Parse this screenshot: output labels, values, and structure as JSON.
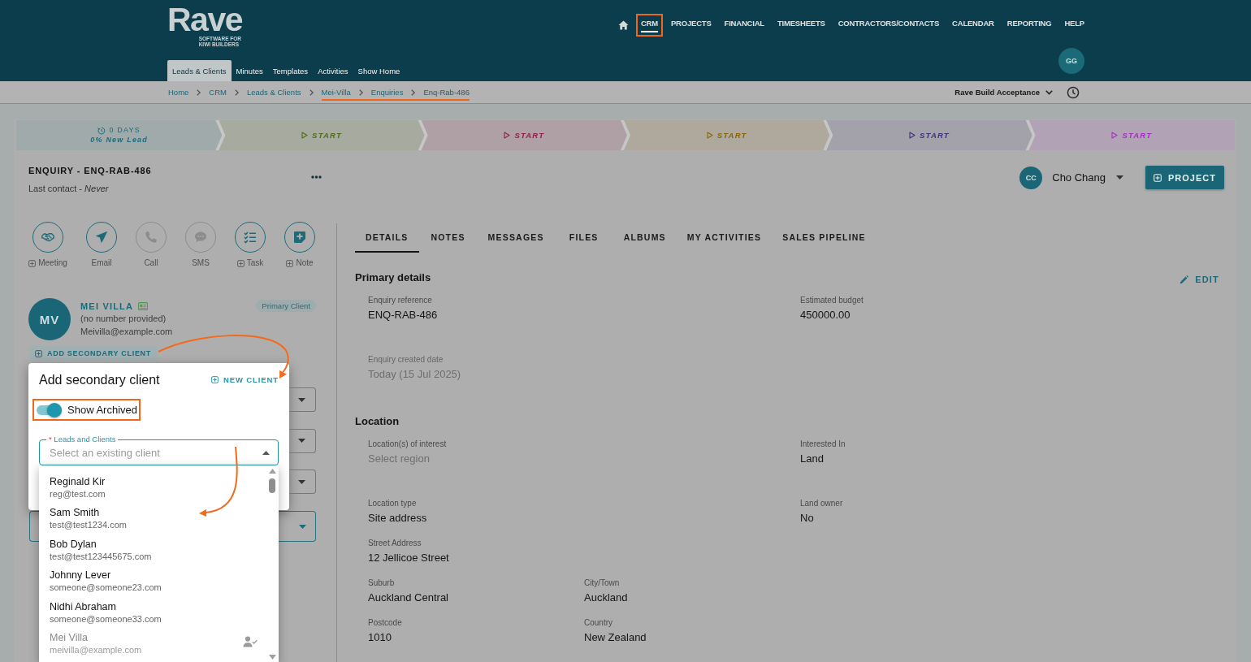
{
  "header": {
    "logo": {
      "name": "Rave",
      "tagline": [
        "SOFTWARE FOR",
        "KIWI BUILDERS"
      ]
    },
    "nav": [
      {
        "label": "CRM",
        "selected": true,
        "highlighted": true
      },
      {
        "label": "PROJECTS",
        "selected": false,
        "highlighted": false
      },
      {
        "label": "FINANCIAL",
        "selected": false,
        "highlighted": false
      },
      {
        "label": "TIMESHEETS",
        "selected": false,
        "highlighted": false
      },
      {
        "label": "CONTRACTORS/CONTACTS",
        "selected": false,
        "highlighted": false
      },
      {
        "label": "CALENDAR",
        "selected": false,
        "highlighted": false
      },
      {
        "label": "REPORTING",
        "selected": false,
        "highlighted": false
      },
      {
        "label": "HELP",
        "selected": false,
        "highlighted": false
      }
    ],
    "subnav": [
      {
        "label": "Leads & Clients",
        "selected": true
      },
      {
        "label": "Minutes",
        "selected": false
      },
      {
        "label": "Templates",
        "selected": false
      },
      {
        "label": "Activities",
        "selected": false
      },
      {
        "label": "Show Home",
        "selected": false
      }
    ],
    "user_initials": "GG"
  },
  "breadcrumbs": {
    "items": [
      {
        "label": "Home",
        "current": false,
        "underlined": false
      },
      {
        "label": "CRM",
        "current": false,
        "underlined": false
      },
      {
        "label": "Leads & Clients",
        "current": false,
        "underlined": false
      },
      {
        "label": "Mei-Villa",
        "current": false,
        "underlined": true
      },
      {
        "label": "Enquiries",
        "current": false,
        "underlined": true
      },
      {
        "label": "Enq-Rab-486",
        "current": true,
        "underlined": true
      }
    ],
    "company": "Rave Build Acceptance"
  },
  "pipeline": [
    {
      "kind": "current",
      "color": "#1d6b79",
      "days": "0 DAYS",
      "status": "0% New Lead"
    },
    {
      "kind": "start",
      "color": "#4e6b1c",
      "label": "START"
    },
    {
      "kind": "start",
      "color": "#8d1f4a",
      "label": "START"
    },
    {
      "kind": "start",
      "color": "#8a6500",
      "label": "START"
    },
    {
      "kind": "start",
      "color": "#3b3278",
      "label": "START"
    },
    {
      "kind": "start",
      "color": "#a22fc0",
      "label": "START"
    }
  ],
  "enquiry": {
    "title": "ENQUIRY - ENQ-RAB-486",
    "last_contact": "Last contact - *Never*",
    "assignee": {
      "initials": "CC",
      "name": "Cho Chang"
    },
    "project_button": "PROJECT"
  },
  "actions": [
    {
      "label": "Meeting",
      "kind": "add",
      "disabled": false
    },
    {
      "label": "Email",
      "kind": "direct",
      "disabled": false
    },
    {
      "label": "Call",
      "kind": "direct",
      "disabled": true
    },
    {
      "label": "SMS",
      "kind": "direct",
      "disabled": true
    },
    {
      "label": "Task",
      "kind": "add",
      "disabled": false
    },
    {
      "label": "Note",
      "kind": "add",
      "disabled": false
    }
  ],
  "client": {
    "initials": "MV",
    "name": "MEI VILLA",
    "phone": "(no number provided)",
    "email": "Meivilla@example.com",
    "badge": "Primary Client"
  },
  "add_secondary_button": "ADD SECONDARY CLIENT",
  "client_form_fields": [
    {
      "focused": false
    },
    {
      "focused": false
    },
    {
      "focused": false
    },
    {
      "focused": true
    }
  ],
  "popup": {
    "title": "Add secondary client",
    "new_client_button": "NEW CLIENT",
    "show_archived": {
      "label": "Show Archived",
      "on": true,
      "highlighted": true
    },
    "field": {
      "required_mark": "*",
      "label": "Leads and Clients",
      "placeholder": "Select an existing client",
      "expanded": true
    },
    "options": [
      {
        "name": "Reginald Kir",
        "email": "reg@test.com",
        "disabled": false
      },
      {
        "name": "Sam Smith",
        "email": "test@test1234.com",
        "disabled": false
      },
      {
        "name": "Bob Dylan",
        "email": "test@test123445675.com",
        "disabled": false
      },
      {
        "name": "Johnny Lever",
        "email": "someone@someone23.com",
        "disabled": false
      },
      {
        "name": "Nidhi Abraham",
        "email": "someone@someone33.com",
        "disabled": false
      },
      {
        "name": "Mei Villa",
        "email": "meivilla@example.com",
        "disabled": true
      }
    ]
  },
  "tabs": [
    {
      "label": "DETAILS",
      "selected": true
    },
    {
      "label": "NOTES",
      "selected": false
    },
    {
      "label": "MESSAGES",
      "selected": false
    },
    {
      "label": "FILES",
      "selected": false
    },
    {
      "label": "ALBUMS",
      "selected": false
    },
    {
      "label": "MY ACTIVITIES",
      "selected": false
    },
    {
      "label": "SALES PIPELINE",
      "selected": false
    }
  ],
  "details": {
    "edit_button": "EDIT",
    "sections": [
      {
        "title": "Primary details",
        "rows": [
          {
            "left": {
              "label": "Enquiry reference",
              "value": "ENQ-RAB-486",
              "disabled": false
            },
            "right": {
              "label": "Estimated budget",
              "value": "450000.00",
              "disabled": false
            }
          },
          {
            "left": {
              "label": "Enquiry created date",
              "value": "Today (15 Jul 2025)",
              "disabled": true
            }
          }
        ]
      },
      {
        "title": "Location",
        "rows": [
          {
            "left": {
              "label": "Location(s) of interest",
              "placeholder": "Select region",
              "disabled": false
            },
            "right": {
              "label": "Interested In",
              "value": "Land",
              "disabled": false
            }
          },
          {
            "left": {
              "label": "Location type",
              "value": "Site address",
              "disabled": false
            },
            "right": {
              "label": "Land owner",
              "value": "No",
              "disabled": false
            }
          },
          {
            "left": {
              "label": "Street Address",
              "value": "12 Jellicoe Street",
              "disabled": false
            }
          },
          {
            "left": {
              "label": "Suburb",
              "value": "Auckland Central",
              "disabled": false
            },
            "middle": {
              "label": "City/Town",
              "value": "Auckland",
              "disabled": false
            }
          },
          {
            "left": {
              "label": "Postcode",
              "value": "1010",
              "disabled": false
            },
            "middle": {
              "label": "Country",
              "value": "New Zealand",
              "disabled": false
            }
          }
        ]
      }
    ]
  }
}
